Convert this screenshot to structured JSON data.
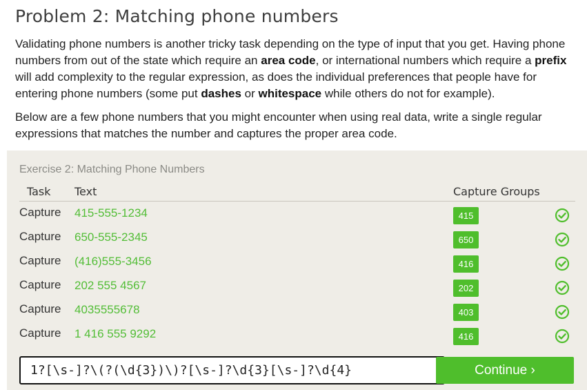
{
  "problem": {
    "title": "Problem 2: Matching phone numbers",
    "paragraph1": {
      "t1": "Validating phone numbers is another tricky task depending on the type of input that you get. Having phone numbers from out of the state which require an ",
      "b1": "area code",
      "t2": ", or international numbers which require a ",
      "b2": "prefix",
      "t3": " will add complexity to the regular expression, as does the individual preferences that people have for entering phone numbers (some put ",
      "b3": "dashes",
      "t4": " or ",
      "b4": "whitespace",
      "t5": " while others do not for example)."
    },
    "paragraph2": "Below are a few phone numbers that you might encounter when using real data, write a single regular expressions that matches the number and captures the proper area code."
  },
  "exercise": {
    "title": "Exercise 2: Matching Phone Numbers",
    "headers": {
      "task": "Task",
      "text": "Text",
      "capture_groups": "Capture Groups"
    },
    "rows": [
      {
        "task": "Capture",
        "text": "415-555-1234",
        "group": "415"
      },
      {
        "task": "Capture",
        "text": "650-555-2345",
        "group": "650"
      },
      {
        "task": "Capture",
        "text": "(416)555-3456",
        "group": "416"
      },
      {
        "task": "Capture",
        "text": "202 555 4567",
        "group": "202"
      },
      {
        "task": "Capture",
        "text": "4035555678",
        "group": "403"
      },
      {
        "task": "Capture",
        "text": "1 416 555 9292",
        "group": "416"
      }
    ],
    "answer_value": "1?[\\s-]?\\(?(\\d{3})\\)?[\\s-]?\\d{3}[\\s-]?\\d{4}",
    "continue_label": "Continue ›"
  },
  "colors": {
    "accent_green": "#4fbe2c",
    "text_green": "#52bd36",
    "panel_bg": "#efede7"
  },
  "icons": {
    "row_status": "check-circle-icon"
  }
}
